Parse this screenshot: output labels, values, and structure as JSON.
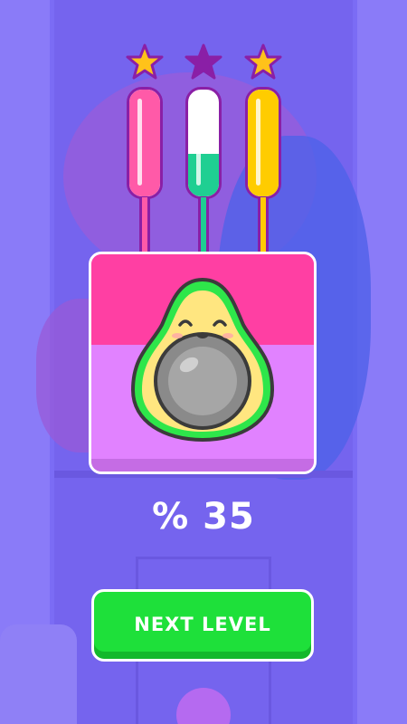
{
  "game": {
    "progress_percent_label": "% 35",
    "progress_percent": 35,
    "next_level_label": "NEXT LEVEL",
    "stars": [
      {
        "state": "earned",
        "color": "#ffc21a"
      },
      {
        "state": "empty",
        "color": "#8a1fa6"
      },
      {
        "state": "earned",
        "color": "#ffc21a"
      }
    ],
    "tubes": [
      {
        "color": "#ff5aa8",
        "fill_fraction": 1.0
      },
      {
        "color": "#1fcf92",
        "fill_fraction": 0.4
      },
      {
        "color": "#ffcc00",
        "fill_fraction": 1.0
      }
    ],
    "character": "avocado",
    "colors": {
      "background": "#7b6cf5",
      "card_top": "#ff3fa3",
      "card_bottom": "#e182ff",
      "button": "#1ee03a"
    }
  }
}
